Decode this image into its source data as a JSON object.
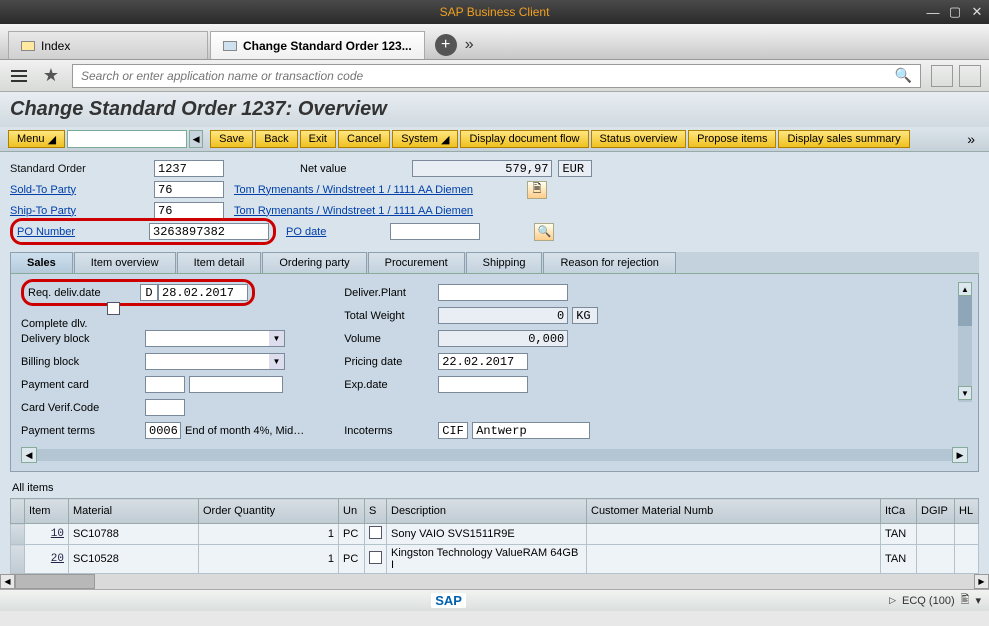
{
  "window": {
    "title": "SAP Business Client"
  },
  "app_tabs": {
    "index": "Index",
    "active": "Change Standard Order 123..."
  },
  "search": {
    "placeholder": "Search or enter application name or transaction code"
  },
  "page": {
    "title": "Change Standard Order 1237: Overview"
  },
  "toolbar": {
    "menu": "Menu",
    "save": "Save",
    "back": "Back",
    "exit": "Exit",
    "cancel": "Cancel",
    "system": "System",
    "flow": "Display document flow",
    "status": "Status overview",
    "propose": "Propose items",
    "summary": "Display sales summary"
  },
  "header": {
    "std_order_label": "Standard Order",
    "std_order": "1237",
    "net_value_label": "Net value",
    "net_value": "579,97",
    "currency": "EUR",
    "sold_to_label": "Sold-To Party",
    "sold_to": "76",
    "ship_to_label": "Ship-To Party",
    "ship_to": "76",
    "party_link": "Tom Rymenants / Windstreet 1 / 1111 AA Diemen",
    "po_number_label": "PO Number",
    "po_number": "3263897382",
    "po_date_label": "PO date"
  },
  "tabs": {
    "sales": "Sales",
    "item_overview": "Item overview",
    "item_detail": "Item detail",
    "ordering_party": "Ordering party",
    "procurement": "Procurement",
    "shipping": "Shipping",
    "rejection": "Reason for rejection"
  },
  "sales": {
    "req_deliv_label": "Req. deliv.date",
    "req_deliv_type": "D",
    "req_deliv_date": "28.02.2017",
    "complete_dlv": "Complete dlv.",
    "delivery_block": "Delivery block",
    "billing_block": "Billing block",
    "payment_card": "Payment card",
    "card_verif": "Card Verif.Code",
    "payment_terms": "Payment terms",
    "payment_terms_val": "0006",
    "payment_terms_desc": "End of month 4%, Mid…",
    "deliver_plant": "Deliver.Plant",
    "total_weight": "Total Weight",
    "total_weight_val": "0",
    "total_weight_unit": "KG",
    "volume": "Volume",
    "volume_val": "0,000",
    "pricing_date": "Pricing date",
    "pricing_date_val": "22.02.2017",
    "exp_date": "Exp.date",
    "incoterms": "Incoterms",
    "incoterms_val": "CIF",
    "incoterms_loc": "Antwerp"
  },
  "allitems": {
    "title": "All items",
    "cols": {
      "item": "Item",
      "material": "Material",
      "qty": "Order Quantity",
      "un": "Un",
      "s": "S",
      "desc": "Description",
      "custmat": "Customer Material Numb",
      "itca": "ItCa",
      "dgip": "DGIP",
      "hl": "HL"
    },
    "rows": [
      {
        "item": "10",
        "material": "SC10788",
        "qty": "1",
        "un": "PC",
        "desc": "Sony VAIO SVS1511R9E",
        "itca": "TAN"
      },
      {
        "item": "20",
        "material": "SC10528",
        "qty": "1",
        "un": "PC",
        "desc": "Kingston Technology ValueRAM 64GB I",
        "itca": "TAN"
      }
    ]
  },
  "status": {
    "sap": "SAP",
    "system": "ECQ (100)"
  }
}
